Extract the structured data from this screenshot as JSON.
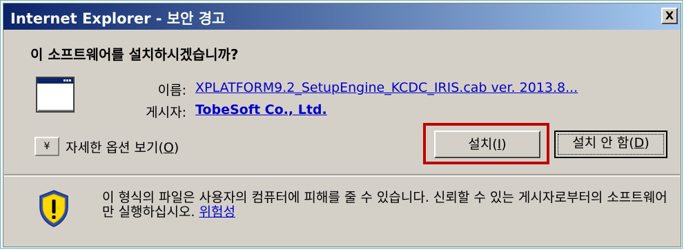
{
  "dialog": {
    "title": "Internet Explorer - 보안 경고",
    "close_label": "X",
    "question": "이 소프트웨어를 설치하시겠습니까?"
  },
  "details": {
    "name_label": "이름:",
    "name_value": "XPLATFORM9.2_SetupEngine_KCDC_IRIS.cab ver. 2013.8...",
    "publisher_label": "게시자:",
    "publisher_value": "TobeSoft Co., Ltd."
  },
  "options": {
    "expander_glyph": "¥",
    "more_options_text": "자세한 옵션 보기(",
    "more_options_key": "O",
    "more_options_close": ")"
  },
  "buttons": {
    "install_text": "설치(",
    "install_key": "I",
    "install_close": ")",
    "dont_install_text": "설치 안 함(",
    "dont_install_key": "D",
    "dont_install_close": ")"
  },
  "warning": {
    "text": "이 형식의 파일은 사용자의 컴퓨터에 피해를 줄 수 있습니다. 신뢰할 수 있는 게시자로부터의 소프트웨어만 실행하십시오. ",
    "link": "위험성"
  },
  "colors": {
    "title_start": "#0a246a",
    "title_end": "#a6caf0",
    "dialog_bg": "#d4d0c8",
    "link": "#0000cc",
    "highlight": "#c00000"
  }
}
